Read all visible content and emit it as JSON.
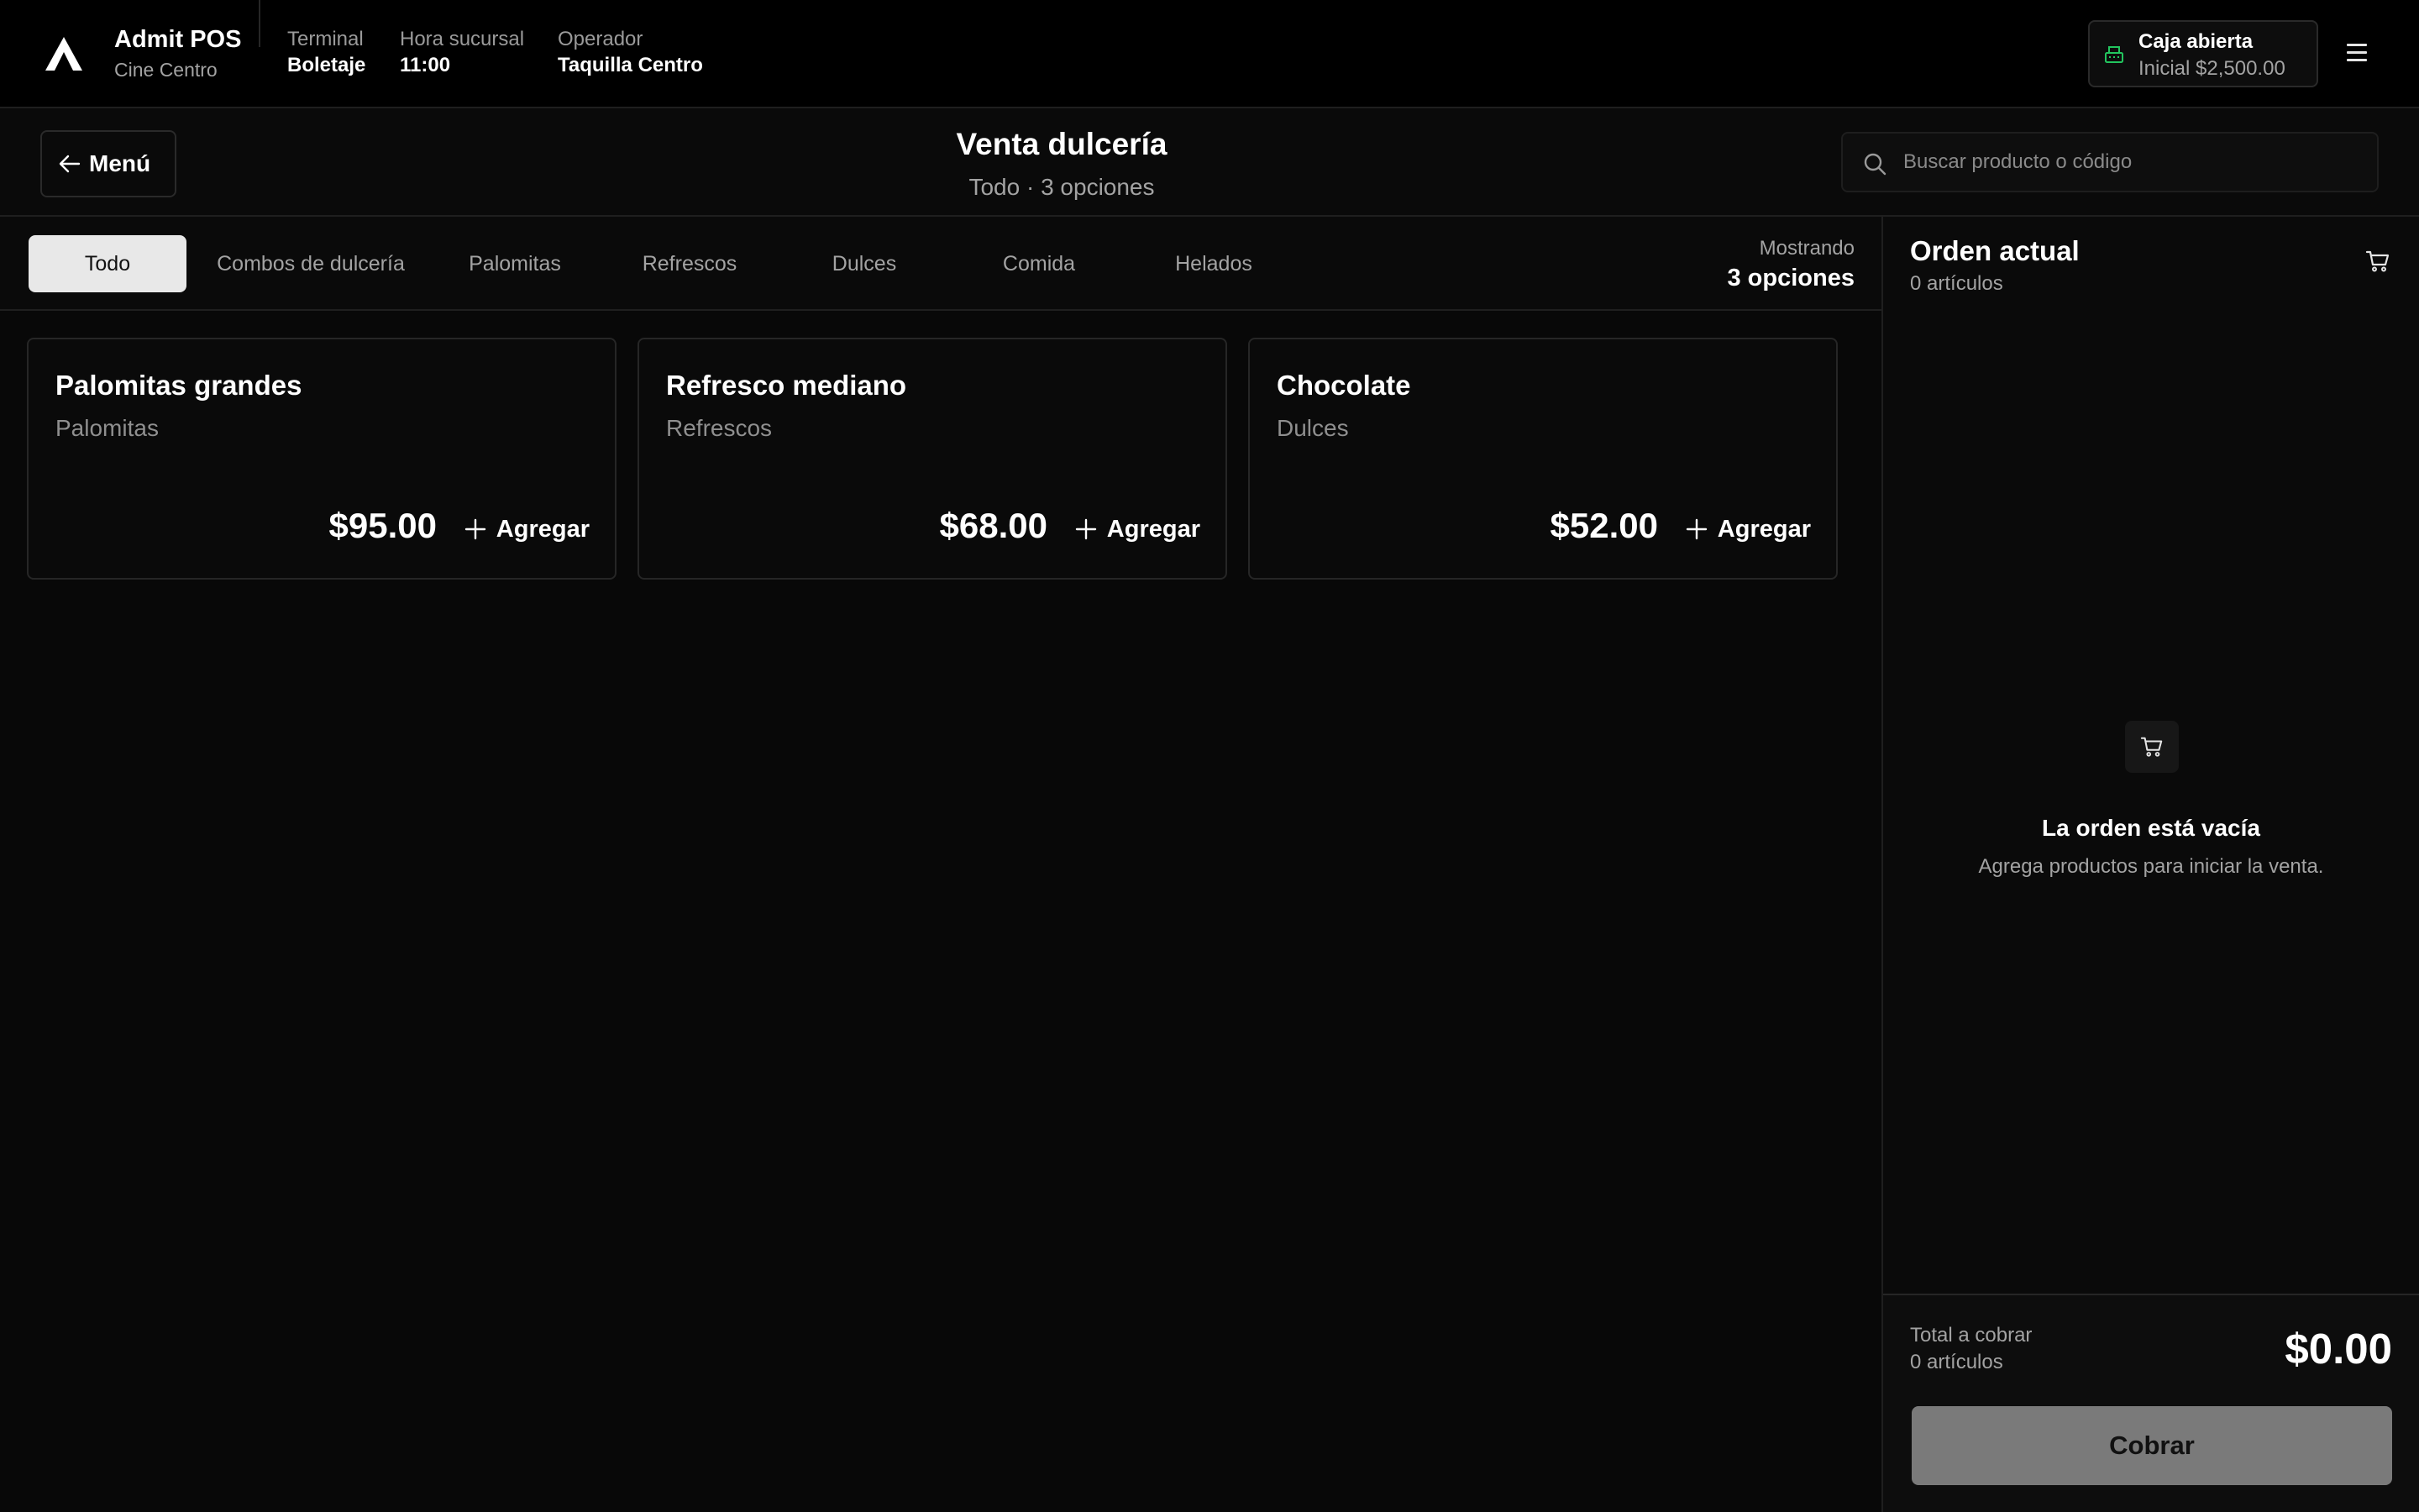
{
  "app": {
    "name": "Admit POS",
    "location": "Cine Centro"
  },
  "meta": [
    {
      "label": "Terminal",
      "value": "Boletaje"
    },
    {
      "label": "Hora sucursal",
      "value": "11:00"
    },
    {
      "label": "Operador",
      "value": "Taquilla Centro"
    }
  ],
  "register": {
    "status": "Caja abierta",
    "initial": "Inicial $2,500.00",
    "icon": "cash-register-icon",
    "icon_color": "#22c55e"
  },
  "subheader": {
    "back_label": "Menú",
    "title": "Venta dulcería",
    "subtitle": "Todo · 3 opciones",
    "search_placeholder": "Buscar producto o código"
  },
  "tabs": [
    {
      "label": "Todo",
      "active": true
    },
    {
      "label": "Combos de dulcería",
      "active": false
    },
    {
      "label": "Palomitas",
      "active": false
    },
    {
      "label": "Refrescos",
      "active": false
    },
    {
      "label": "Dulces",
      "active": false
    },
    {
      "label": "Comida",
      "active": false
    },
    {
      "label": "Helados",
      "active": false
    }
  ],
  "showing": {
    "label": "Mostrando",
    "value": "3 opciones"
  },
  "products": [
    {
      "name": "Palomitas grandes",
      "category": "Palomitas",
      "price": "$95.00",
      "add_label": "Agregar"
    },
    {
      "name": "Refresco mediano",
      "category": "Refrescos",
      "price": "$68.00",
      "add_label": "Agregar"
    },
    {
      "name": "Chocolate",
      "category": "Dulces",
      "price": "$52.00",
      "add_label": "Agregar"
    }
  ],
  "order": {
    "title": "Orden actual",
    "count": "0 artículos",
    "empty_title": "La orden está vacía",
    "empty_desc": "Agrega productos para iniciar la venta.",
    "total_label": "Total a cobrar",
    "total_count": "0 artículos",
    "total_value": "$0.00",
    "charge_label": "Cobrar"
  }
}
